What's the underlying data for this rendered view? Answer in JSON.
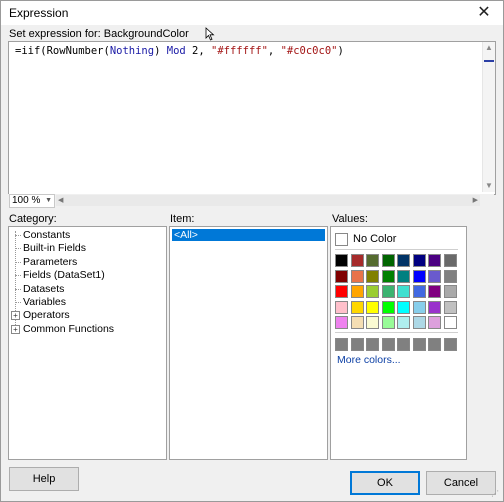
{
  "window": {
    "title": "Expression",
    "close_glyph": "✕"
  },
  "expression": {
    "label": "Set expression for: BackgroundColor",
    "tokens": [
      {
        "text": "=iif(RowNumber(",
        "kind": "plain"
      },
      {
        "text": "Nothing",
        "kind": "kw"
      },
      {
        "text": ") ",
        "kind": "plain"
      },
      {
        "text": "Mod",
        "kind": "kw"
      },
      {
        "text": " 2, ",
        "kind": "plain"
      },
      {
        "text": "\"#ffffff\"",
        "kind": "str"
      },
      {
        "text": ", ",
        "kind": "plain"
      },
      {
        "text": "\"#c0c0c0\"",
        "kind": "str"
      },
      {
        "text": ")",
        "kind": "plain"
      }
    ],
    "zoom": "100 %"
  },
  "category": {
    "label": "Category:",
    "items": [
      {
        "label": "Constants",
        "expandable": false
      },
      {
        "label": "Built-in Fields",
        "expandable": false
      },
      {
        "label": "Parameters",
        "expandable": false
      },
      {
        "label": "Fields (DataSet1)",
        "expandable": false
      },
      {
        "label": "Datasets",
        "expandable": false
      },
      {
        "label": "Variables",
        "expandable": false
      },
      {
        "label": "Operators",
        "expandable": true
      },
      {
        "label": "Common Functions",
        "expandable": true
      }
    ]
  },
  "item": {
    "label": "Item:",
    "selected": "<All>"
  },
  "values": {
    "label": "Values:",
    "no_color": "No Color",
    "more_colors": "More colors...",
    "swatches": [
      [
        "#000000",
        "#a52a2a",
        "#556b2f",
        "#006400",
        "#003366",
        "#000080",
        "#4b0082",
        "#696969"
      ],
      [
        "#800000",
        "#e8734a",
        "#808000",
        "#008000",
        "#008080",
        "#0000ff",
        "#6a5acd",
        "#808080"
      ],
      [
        "#ff0000",
        "#ffa500",
        "#9acd32",
        "#3cb371",
        "#40e0d0",
        "#4169e1",
        "#800080",
        "#a9a9a9"
      ],
      [
        "#ffc0cb",
        "#ffd700",
        "#ffff00",
        "#00ff00",
        "#00ffff",
        "#87ceeb",
        "#9932cc",
        "#c0c0c0"
      ],
      [
        "#ee82ee",
        "#f5deb3",
        "#fafad2",
        "#98fb98",
        "#afeeee",
        "#add8e6",
        "#dda0dd",
        "#ffffff"
      ]
    ],
    "recent": [
      "#808080",
      "#808080",
      "#808080",
      "#808080",
      "#808080",
      "#808080",
      "#808080",
      "#808080"
    ]
  },
  "buttons": {
    "help": "Help",
    "ok": "OK",
    "cancel": "Cancel"
  },
  "colors": {
    "selection": "#0078d7",
    "link": "#0b3fa5"
  }
}
